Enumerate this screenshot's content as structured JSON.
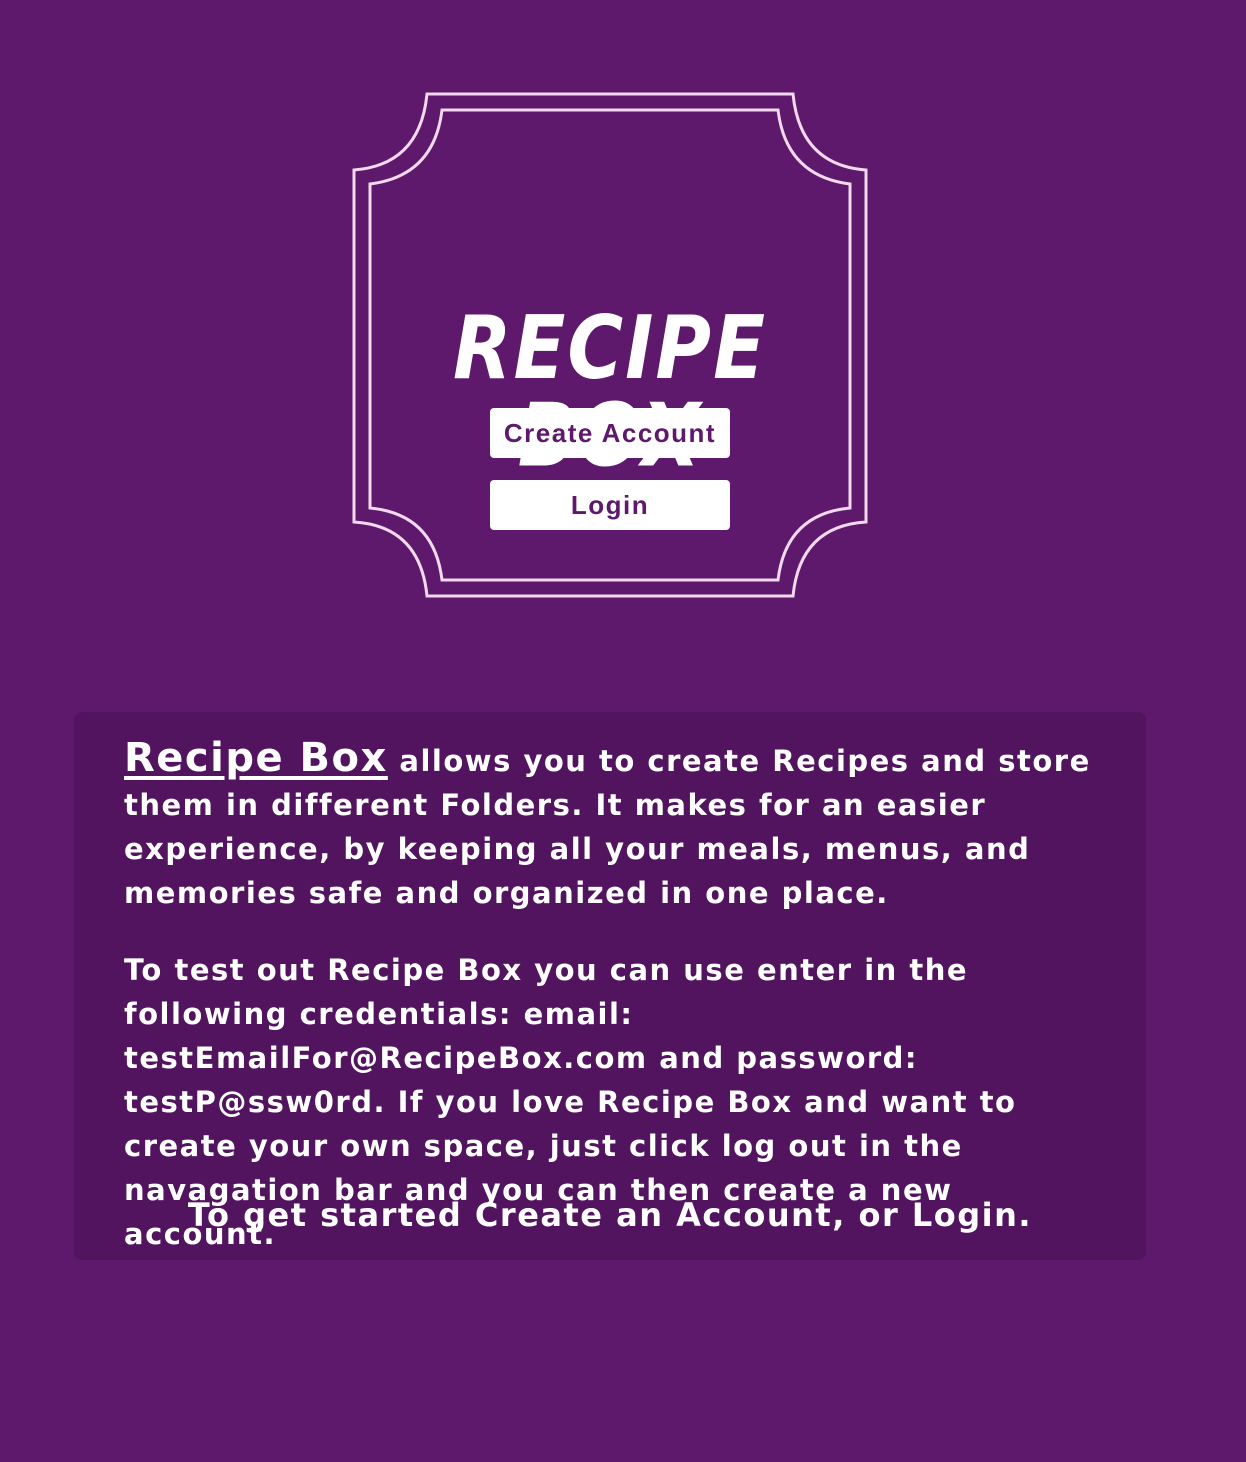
{
  "logo": {
    "title": "RECIPE BOX"
  },
  "buttons": {
    "create_account": "Create Account",
    "login": "Login"
  },
  "info": {
    "brand": "Recipe Box",
    "intro": "allows you to create Recipes and store them in different Folders. It makes for an easier experience, by keeping all your meals, menus, and memories safe and organized in one place.",
    "test_credentials": "To test out Recipe Box you can use enter in the following credentials: email: testEmailFor@RecipeBox.com and password: testP@ssw0rd. If you love Recipe Box and want to create your own space, just click log out in the navagation bar and you can then create a new account.",
    "cta": "To get started Create an Account, or Login."
  },
  "colors": {
    "background": "#5e186c",
    "panel": "#52145f",
    "frame": "#f3d9ee",
    "text": "#ffffff"
  }
}
